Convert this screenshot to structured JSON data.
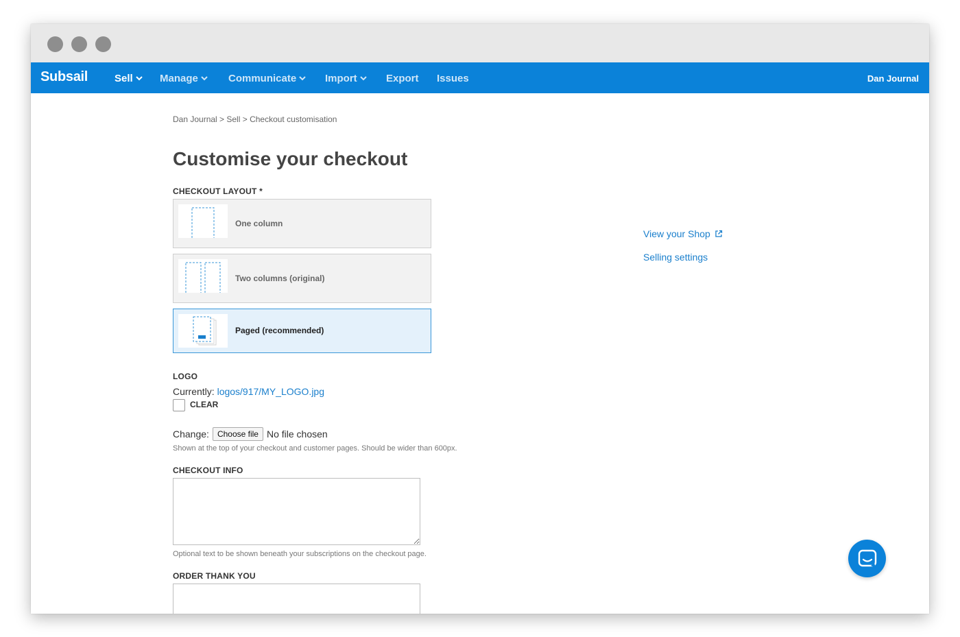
{
  "nav": {
    "brand": "Subsail",
    "items": [
      {
        "label": "Sell",
        "dropdown": true
      },
      {
        "label": "Manage",
        "dropdown": true
      },
      {
        "label": "Communicate",
        "dropdown": true
      },
      {
        "label": "Import",
        "dropdown": true
      },
      {
        "label": "Export",
        "dropdown": false
      },
      {
        "label": "Issues",
        "dropdown": false
      }
    ],
    "user": "Dan Journal"
  },
  "breadcrumb": "Dan Journal > Sell > Checkout customisation",
  "page_title": "Customise your checkout",
  "layout": {
    "label": "CHECKOUT LAYOUT *",
    "options": [
      {
        "label": "One column",
        "selected": false
      },
      {
        "label": "Two columns (original)",
        "selected": false
      },
      {
        "label": "Paged (recommended)",
        "selected": true
      }
    ]
  },
  "logo": {
    "label": "LOGO",
    "current_prefix": "Currently:",
    "current_file": "logos/917/MY_LOGO.jpg",
    "clear_label": "CLEAR",
    "change_label": "Change:",
    "choose_button": "Choose file",
    "file_status": "No file chosen",
    "help": "Shown at the top of your checkout and customer pages. Should be wider than 600px."
  },
  "checkout_info": {
    "label": "CHECKOUT INFO",
    "value": "",
    "help": "Optional text to be shown beneath your subscriptions on the checkout page."
  },
  "order_thank_you": {
    "label": "ORDER THANK YOU",
    "value": ""
  },
  "side_links": {
    "view_shop": "View your Shop",
    "selling_settings": "Selling settings"
  },
  "icons": {
    "chevron": "chevron-down-icon",
    "external": "external-link-icon",
    "chat": "chat-icon"
  },
  "colors": {
    "accent": "#0b82d9",
    "link": "#1a7fcc",
    "selected_bg": "#e4f1fb"
  }
}
